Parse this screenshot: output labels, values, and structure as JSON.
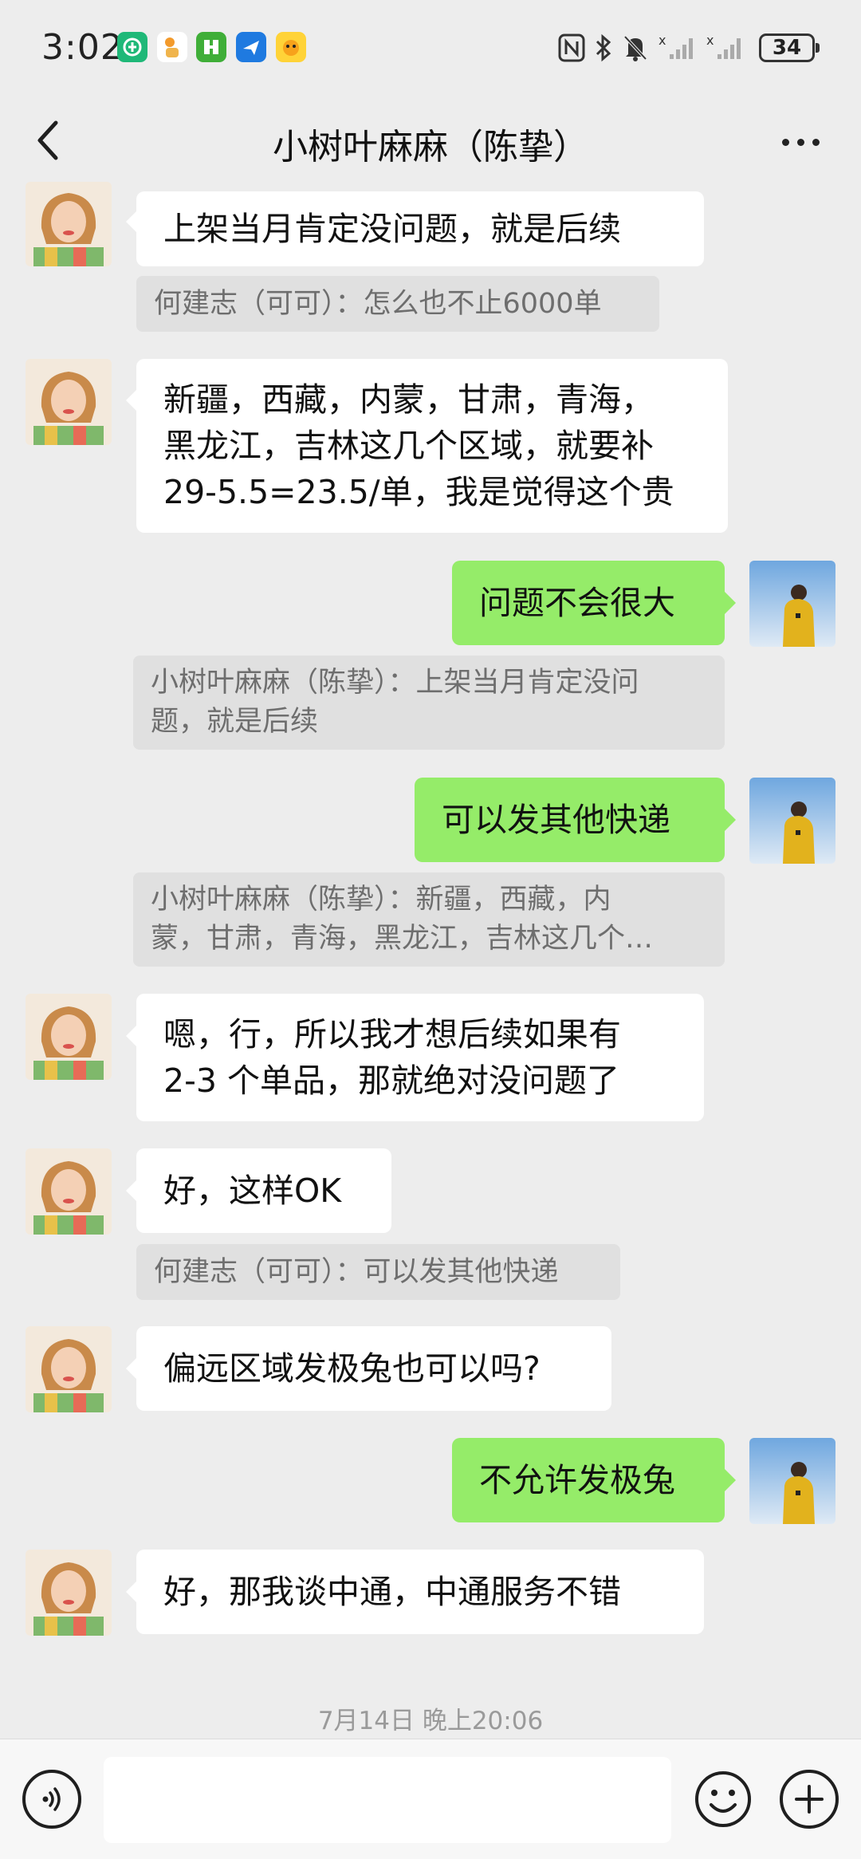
{
  "status_bar": {
    "time": "3:02",
    "battery": "34",
    "app_icons": [
      "app-icon-green",
      "app-icon-orange",
      "app-icon-green-square",
      "app-icon-blue-plane",
      "app-icon-yellow"
    ],
    "system_icons": [
      "nfc-icon",
      "bluetooth-icon",
      "mute-icon",
      "signal-icon",
      "signal-icon"
    ]
  },
  "nav": {
    "title": "小树叶麻麻（陈挚）"
  },
  "messages": {
    "m1": {
      "side": "left",
      "text": "上架当月肯定没问题，就是后续"
    },
    "q1": {
      "text": "何建志（可可）：怎么也不止6000单"
    },
    "m2": {
      "side": "left",
      "text": "新疆，西藏，内蒙，甘肃，青海，\n黑龙江，吉林这几个区域，就要补\n29-5.5=23.5/单，我是觉得这个贵"
    },
    "m3": {
      "side": "right",
      "text": "问题不会很大"
    },
    "q2": {
      "text": "小树叶麻麻（陈挚）：上架当月肯定没问\n题，就是后续"
    },
    "m4": {
      "side": "right",
      "text": "可以发其他快递"
    },
    "q3": {
      "text": "小树叶麻麻（陈挚）：新疆，西藏，内\n蒙，甘肃，青海，黑龙江，吉林这几个…"
    },
    "m5": {
      "side": "left",
      "text": "嗯，行，所以我才想后续如果有\n2-3 个单品，那就绝对没问题了"
    },
    "m6": {
      "side": "left",
      "text": "好，这样OK"
    },
    "q4": {
      "text": "何建志（可可）：可以发其他快递"
    },
    "m7": {
      "side": "left",
      "text": "偏远区域发极兔也可以吗?"
    },
    "m8": {
      "side": "right",
      "text": "不允许发极兔"
    },
    "m9": {
      "side": "left",
      "text": "好，那我谈中通，中通服务不错"
    }
  },
  "timestamp": "7月14日 晚上20:06",
  "input": {
    "value": "",
    "voice_icon": "voice-icon",
    "emoji_icon": "emoji-icon",
    "add_icon": "plus-icon"
  },
  "colors": {
    "background": "#ededed",
    "bubble_self": "#95ec69",
    "bubble_other": "#ffffff",
    "quote_bg": "#e0e0e0"
  }
}
